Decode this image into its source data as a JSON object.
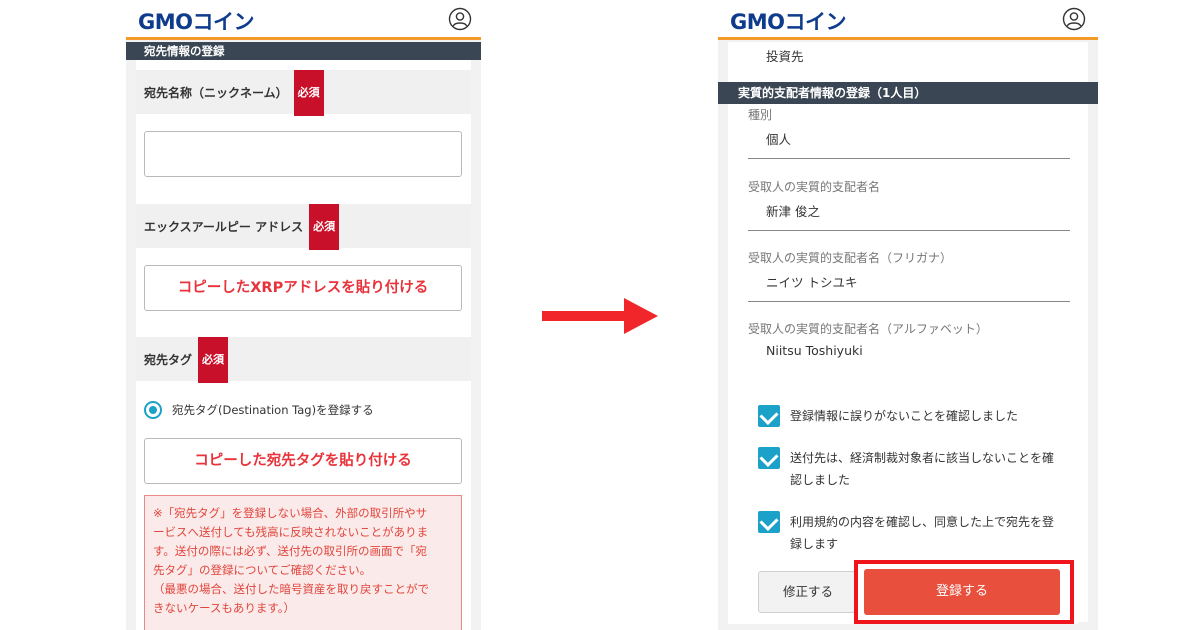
{
  "left": {
    "logo_gmo": "GMO",
    "logo_coin": "コイン",
    "section_title": "宛先情報の登録",
    "required_badge": "必須",
    "nickname_label": "宛先名称（ニックネーム）",
    "address_label": "エックスアールピー アドレス",
    "paste_address_button": "コピーしたXRPアドレスを貼り付ける",
    "tag_label": "宛先タグ",
    "radio_label": "宛先タグ(Destination Tag)を登録する",
    "paste_tag_button": "コピーした宛先タグを貼り付ける",
    "warning_lines": [
      "※「宛先タグ」を登録しない場合、外部の取引所やサ",
      "ービスへ送付しても残高に反映されないことがありま",
      "す。送付の際には必ず、送付先の取引所の画面で「宛",
      "先タグ」の登録についてご確認ください。",
      "（最悪の場合、送付した暗号資産を取り戻すことがで",
      "きないケースもあります。）"
    ]
  },
  "right": {
    "logo_gmo": "GMO",
    "logo_coin": "コイン",
    "top_value": "投資先",
    "section_title": "実質的支配者情報の登録（1人目）",
    "fields": [
      {
        "label": "種別",
        "value": "個人"
      },
      {
        "label": "受取人の実質的支配者名",
        "value": "新津 俊之"
      },
      {
        "label": "受取人の実質的支配者名（フリガナ）",
        "value": "ニイツ トシユキ"
      },
      {
        "label": "受取人の実質的支配者名（アルファベット）",
        "value": "Niitsu Toshiyuki"
      }
    ],
    "checks": [
      "登録情報に誤りがないことを確認しました",
      "送付先は、経済制裁対象者に該当しないことを確認しました",
      "利用規約の内容を確認し、同意した上で宛先を登録します"
    ],
    "fix_button": "修正する",
    "register_button": "登録する"
  },
  "colors": {
    "accent_orange": "#f39a2b",
    "header_bar": "#3a4653",
    "required_red": "#c9102a",
    "paste_red": "#e8333b",
    "check_blue": "#1ca1c9",
    "register_red": "#e84f3d",
    "arrow_red": "#f0262b",
    "logo_blue": "#0e3b8c"
  }
}
